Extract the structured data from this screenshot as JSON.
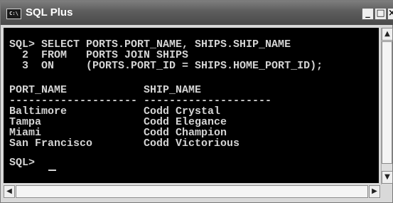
{
  "window": {
    "title": "SQL Plus",
    "icon_text": "C:\\"
  },
  "title_buttons": {
    "minimize": "_",
    "maximize": "□",
    "close": "×"
  },
  "console": {
    "lines": [
      "SQL> SELECT PORTS.PORT_NAME, SHIPS.SHIP_NAME",
      "  2  FROM   PORTS JOIN SHIPS",
      "  3  ON     (PORTS.PORT_ID = SHIPS.HOME_PORT_ID);",
      "",
      "PORT_NAME            SHIP_NAME",
      "-------------------- --------------------",
      "Baltimore            Codd Crystal",
      "Tampa                Codd Elegance",
      "Miami                Codd Champion",
      "San Francisco        Codd Victorious",
      "",
      "SQL> "
    ]
  },
  "scrollbars": {
    "up": "▲",
    "down": "▼",
    "left": "◀",
    "right": "▶"
  }
}
